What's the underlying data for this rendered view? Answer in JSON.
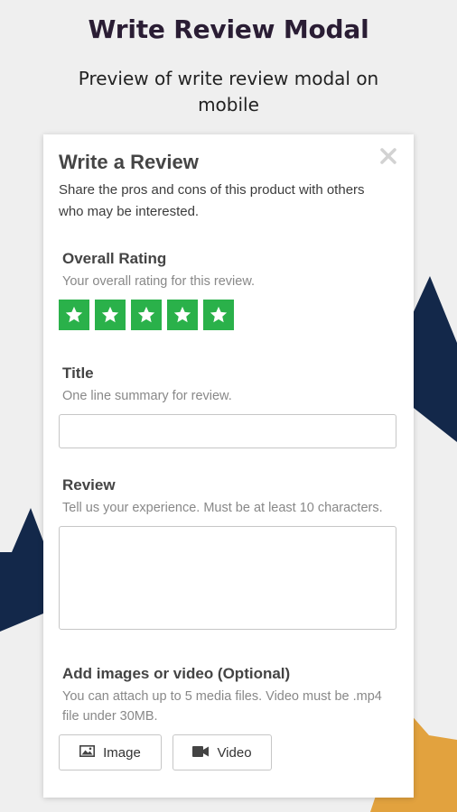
{
  "header": {
    "title": "Write Review Modal",
    "subtitle": "Preview of write review modal on mobile"
  },
  "modal": {
    "title": "Write a Review",
    "description": "Share the pros and cons of this product with others who may be interested.",
    "close_icon": "close-icon",
    "rating": {
      "label": "Overall Rating",
      "hint": "Your overall rating for this review.",
      "stars_selected": 5,
      "stars_total": 5,
      "star_color": "#2ab14a"
    },
    "title_field": {
      "label": "Title",
      "hint": "One line summary for review.",
      "value": ""
    },
    "review_field": {
      "label": "Review",
      "hint": "Tell us your experience. Must be at least 10 characters.",
      "value": ""
    },
    "media": {
      "label": "Add images or video (Optional)",
      "hint": "You can attach up to 5 media files. Video must be .mp4 file under 30MB.",
      "image_button": "Image",
      "image_icon": "image-icon",
      "video_button": "Video",
      "video_icon": "video-camera-icon"
    }
  },
  "colors": {
    "background": "#efefef",
    "navy_star": "#13284a",
    "gold_star": "#e2a23e",
    "heading": "#2a1d34"
  }
}
